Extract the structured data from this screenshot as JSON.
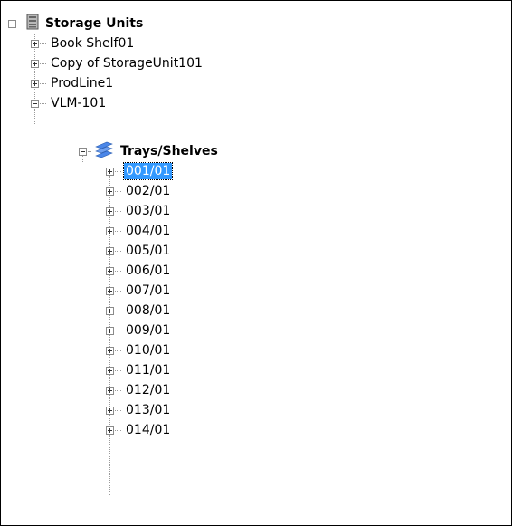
{
  "tree": {
    "root_label": "Storage Units",
    "units": [
      {
        "label": "Book Shelf01"
      },
      {
        "label": "Copy of StorageUnit101"
      },
      {
        "label": "ProdLine1"
      },
      {
        "label": "VLM-101"
      }
    ],
    "trays_label": "Trays/Shelves",
    "trays": [
      {
        "label": "001/01",
        "selected": true
      },
      {
        "label": "002/01"
      },
      {
        "label": "003/01"
      },
      {
        "label": "004/01"
      },
      {
        "label": "005/01"
      },
      {
        "label": "006/01"
      },
      {
        "label": "007/01"
      },
      {
        "label": "008/01"
      },
      {
        "label": "009/01"
      },
      {
        "label": "010/01"
      },
      {
        "label": "011/01"
      },
      {
        "label": "012/01"
      },
      {
        "label": "013/01"
      },
      {
        "label": "014/01"
      }
    ],
    "icons": {
      "root": "storage-unit-icon",
      "trays": "trays-shelves-icon"
    },
    "colors": {
      "selection": "#3399ff"
    }
  }
}
